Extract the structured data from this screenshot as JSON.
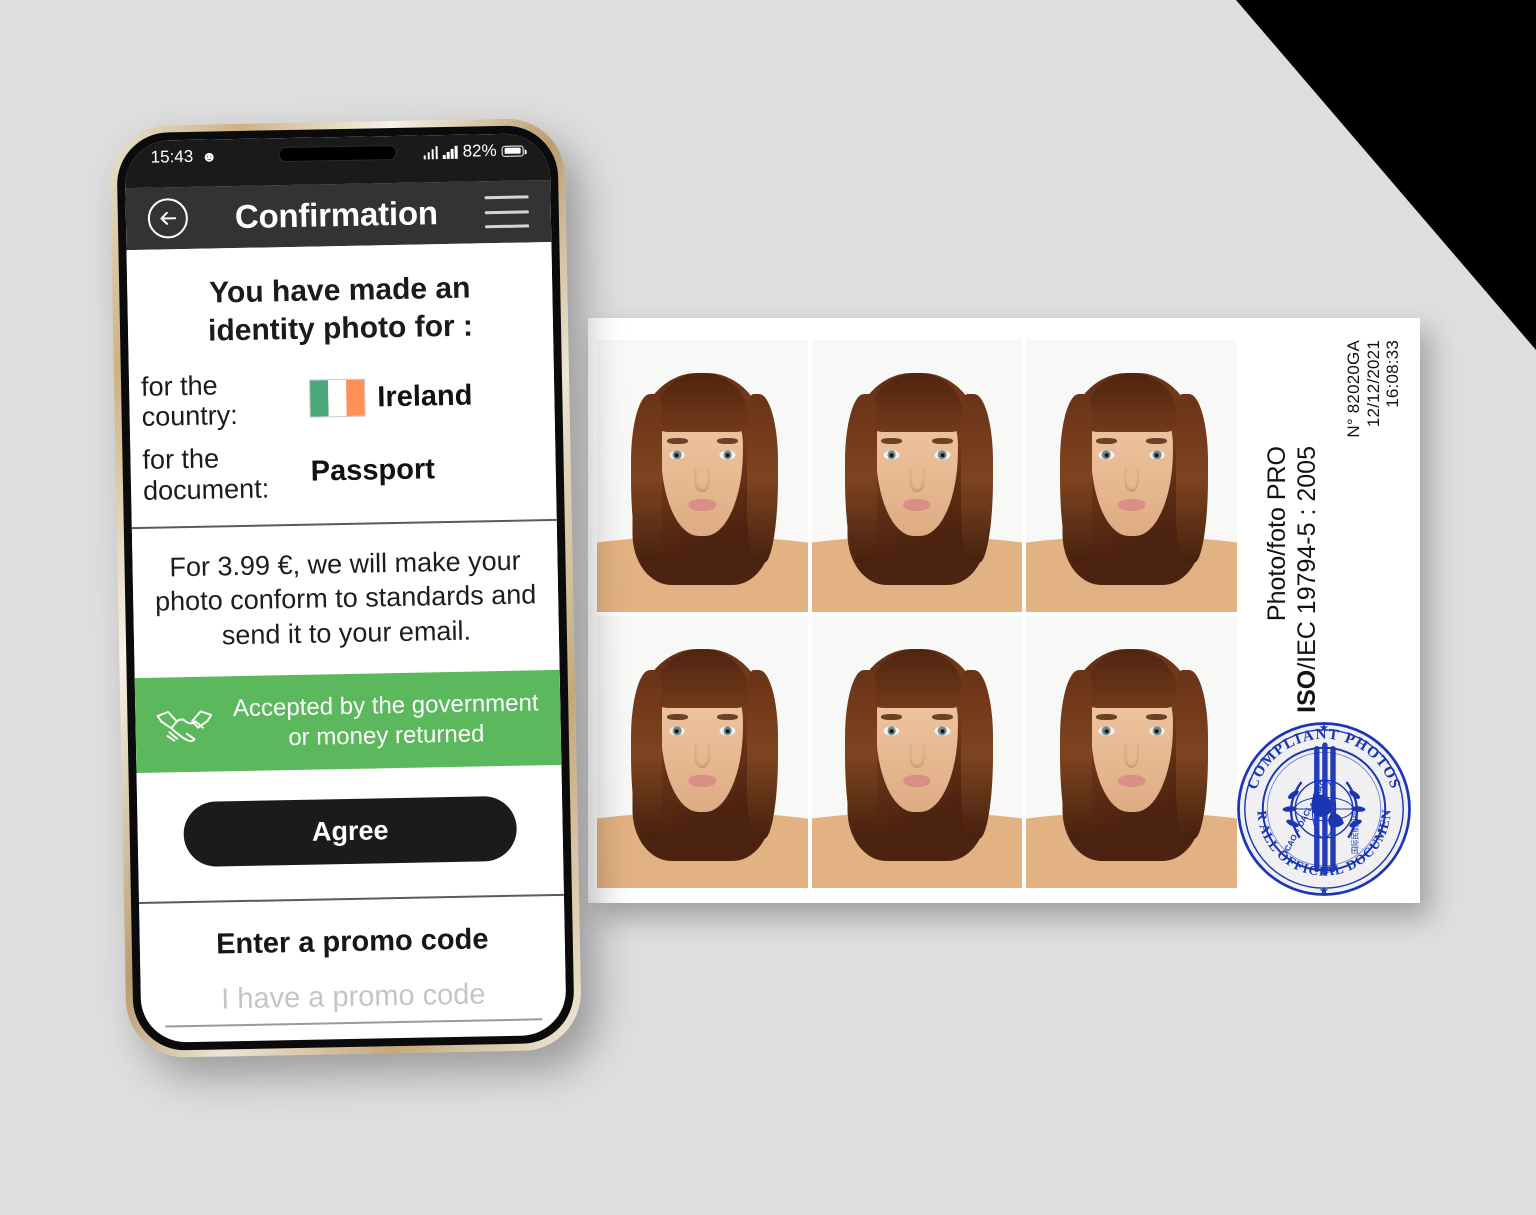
{
  "background": {
    "color": "#dedede",
    "corner_accent_color": "#000000"
  },
  "phone": {
    "status_bar": {
      "time": "15:43",
      "left_icon": "snapchat-icon",
      "signal_icon": "signal-bars-icon",
      "wifi_icon": "signal-bars-icon",
      "battery_percent": "82%",
      "battery_icon": "battery-icon"
    },
    "header": {
      "back_icon": "back-arrow-icon",
      "title": "Confirmation",
      "menu_icon": "hamburger-menu-icon"
    },
    "content": {
      "headline": "You have made an identity photo for :",
      "rows": [
        {
          "label": "for the country:",
          "value": "Ireland",
          "icon": "ireland-flag-icon"
        },
        {
          "label": "for the document:",
          "value": "Passport",
          "icon": ""
        }
      ],
      "price_text": "For 3.99 €, we will make your photo conform to standards and send it to your email.",
      "price_amount": "3.99 €",
      "guarantee": {
        "icon": "handshake-icon",
        "text": "Accepted by the government or money returned",
        "background_color": "#5cb85c"
      },
      "agree_label": "Agree",
      "promo": {
        "title": "Enter a promo code",
        "placeholder": "I have a promo code",
        "value": ""
      }
    },
    "flag_colors": {
      "green": "#4ca87a",
      "white": "#ffffff",
      "orange": "#ff9157"
    }
  },
  "photo_sheet": {
    "photo_count": 6,
    "photo_alt": "passport-portrait",
    "serial": "N° 82020GA",
    "date": "12/12/2021",
    "time": "16:08:33",
    "brand": "Photo/foto PRO",
    "standard_bold": "ISO",
    "standard_rest": "/IEC 19794-5 : 2005",
    "seal": {
      "outer_top": "COMPLIANT PHOTOS",
      "outer_bottom": "FOR ALL OFFICIAL DOCUMENTS",
      "inner": [
        "ICAO",
        "OACI",
        "ИКАО"
      ],
      "color": "#1a35b5"
    }
  }
}
